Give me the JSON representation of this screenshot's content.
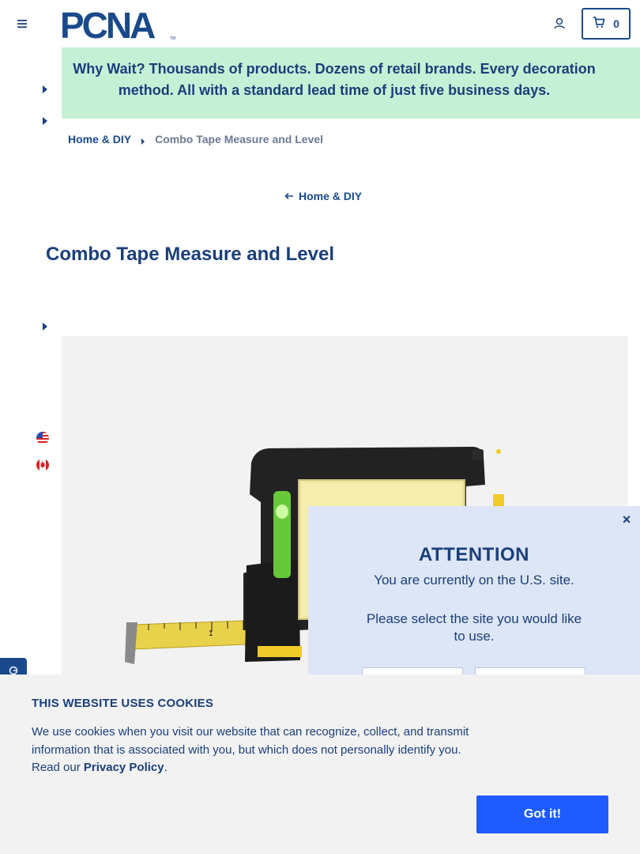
{
  "header": {
    "logo_text": "PCNA",
    "logo_tm": "TM",
    "cart_count": "0"
  },
  "promo": {
    "text": "Why Wait? Thousands of products. Dozens of retail brands. Every decoration method. All with a standard lead time of just five business days."
  },
  "breadcrumb": {
    "parent": "Home & DIY",
    "current": "Combo Tape Measure and Level"
  },
  "back_link": "Home & DIY",
  "product": {
    "title": "Combo Tape Measure and Level"
  },
  "modal": {
    "heading": "ATTENTION",
    "message1": "You are currently on the U.S. site.",
    "message2": "Please select the site you would like to use.",
    "close": "×"
  },
  "cookie": {
    "heading": "THIS WEBSITE USES COOKIES",
    "body": "We use cookies when you visit our website that can recognize, collect, and transmit information that is associated with you, but which does not personally identify you. Read our ",
    "link": "Privacy Policy",
    "end": ".",
    "button": "Got it!"
  },
  "colors": {
    "brand": "#1a4a8c",
    "promo_bg": "#c6f0d6",
    "modal_bg": "#dde6f6",
    "cta": "#1e5cff"
  },
  "icons": [
    "menu-icon",
    "user-icon",
    "cart-icon",
    "chevron-right-icon",
    "arrow-left-icon",
    "us-flag-icon",
    "canada-flag-icon",
    "close-icon"
  ]
}
